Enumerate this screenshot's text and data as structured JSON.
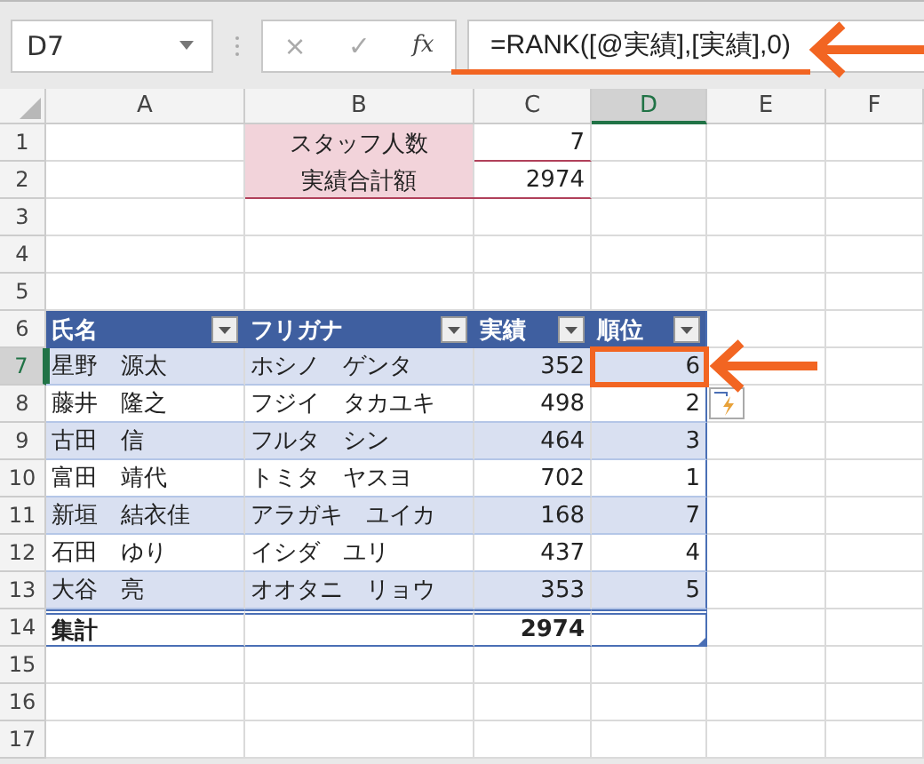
{
  "formula_bar": {
    "name_box": "D7",
    "cancel": "×",
    "enter": "✓",
    "function": "fx",
    "formula": "=RANK([@実績],[実績],0)"
  },
  "column_headers": [
    {
      "label": "A",
      "selected": false
    },
    {
      "label": "B",
      "selected": false
    },
    {
      "label": "C",
      "selected": false
    },
    {
      "label": "D",
      "selected": true
    },
    {
      "label": "E",
      "selected": false
    },
    {
      "label": "F",
      "selected": false
    }
  ],
  "row_headers": [
    {
      "label": "1",
      "selected": false
    },
    {
      "label": "2",
      "selected": false
    },
    {
      "label": "3",
      "selected": false
    },
    {
      "label": "4",
      "selected": false
    },
    {
      "label": "5",
      "selected": false
    },
    {
      "label": "6",
      "selected": false
    },
    {
      "label": "7",
      "selected": true
    },
    {
      "label": "8",
      "selected": false
    },
    {
      "label": "9",
      "selected": false
    },
    {
      "label": "10",
      "selected": false
    },
    {
      "label": "11",
      "selected": false
    },
    {
      "label": "12",
      "selected": false
    },
    {
      "label": "13",
      "selected": false
    },
    {
      "label": "14",
      "selected": false
    },
    {
      "label": "15",
      "selected": false
    },
    {
      "label": "16",
      "selected": false
    },
    {
      "label": "17",
      "selected": false
    }
  ],
  "summary": [
    {
      "label": "スタッフ人数",
      "value": "7"
    },
    {
      "label": "実績合計額",
      "value": "2974"
    }
  ],
  "table": {
    "columns": [
      "氏名",
      "フリガナ",
      "実績",
      "順位"
    ],
    "rows": [
      {
        "name": "星野　源太",
        "kana": "ホシノ　ゲンタ",
        "result": "352",
        "rank": "6",
        "selected": true
      },
      {
        "name": "藤井　隆之",
        "kana": "フジイ　タカユキ",
        "result": "498",
        "rank": "2",
        "selected": false
      },
      {
        "name": "古田　信",
        "kana": "フルタ　シン",
        "result": "464",
        "rank": "3",
        "selected": false
      },
      {
        "name": "富田　靖代",
        "kana": "トミタ　ヤスヨ",
        "result": "702",
        "rank": "1",
        "selected": false
      },
      {
        "name": "新垣　結衣佳",
        "kana": "アラガキ　ユイカ",
        "result": "168",
        "rank": "7",
        "selected": false
      },
      {
        "name": "石田　ゆり",
        "kana": "イシダ　ユリ",
        "result": "437",
        "rank": "4",
        "selected": false
      },
      {
        "name": "大谷　亮",
        "kana": "オオタニ　リョウ",
        "result": "353",
        "rank": "5",
        "selected": false
      }
    ],
    "total": {
      "label": "集計",
      "value": "2974"
    }
  }
}
